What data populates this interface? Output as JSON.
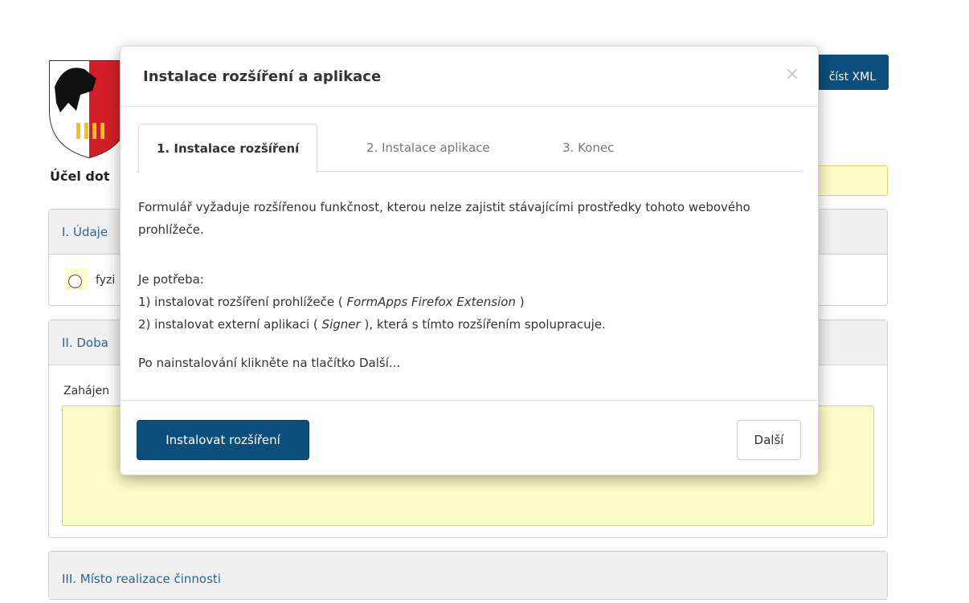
{
  "page": {
    "read_xml_label": "číst XML",
    "purpose_label": "Účel dot",
    "section1": {
      "title": "I. Údaje",
      "radio_label": "fyzi"
    },
    "section2": {
      "title": "II. Doba",
      "start_label": "Zahájen"
    },
    "section3": {
      "title": "III. Místo realizace činnosti"
    }
  },
  "modal": {
    "title": "Instalace rozšíření a aplikace",
    "close_label": "×",
    "tabs": [
      {
        "label": "1. Instalace rozšíření",
        "active": true
      },
      {
        "label": "2. Instalace aplikace",
        "active": false
      },
      {
        "label": "3. Konec",
        "active": false
      }
    ],
    "intro": "Formulář vyžaduje rozšířenou funkčnost, kterou nelze zajistit stávajícími prostředky tohoto webového prohlížeče.",
    "need_title": "Je potřeba:",
    "need_1_pre": "1) instalovat rozšíření prohlížeče ( ",
    "need_1_em": "FormApps Firefox Extension",
    "need_1_post": " )",
    "need_2_pre": "2) instalovat externí aplikaci ( ",
    "need_2_em": "Signer",
    "need_2_post": " ), která s tímto rozšířením spolupracuje.",
    "after": "Po nainstalování klikněte na tlačítko Další...",
    "install_button": "Instalovat rozšíření",
    "next_button": "Další"
  },
  "colors": {
    "primary": "#0d4f7c",
    "field_yellow": "#fdfdc9",
    "panel_title": "#2a6496"
  }
}
